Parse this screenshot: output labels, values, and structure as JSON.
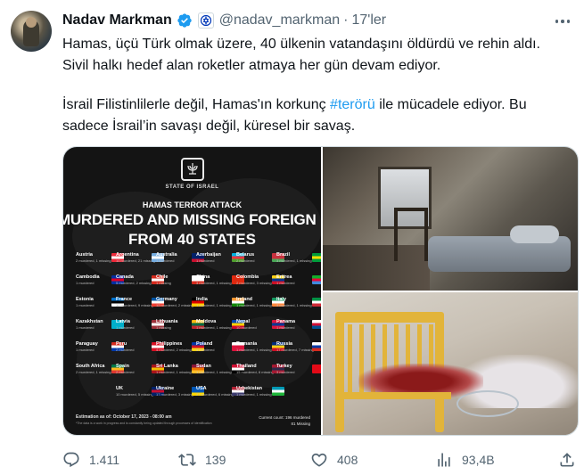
{
  "tweet": {
    "display_name": "Nadav Markman",
    "handle": "@nadav_markman",
    "separator": "·",
    "time": "17'ler",
    "paragraph1_line1": "Hamas, üçü Türk olmak üzere, 40 ülkenin vatandaşını öldürdü ve rehin aldı.",
    "paragraph1_line2": "Sivil halkı hedef alan roketler atmaya her gün devam ediyor.",
    "paragraph2_before": "İsrail Filistinlilerle değil, Hamas'ın korkunç ",
    "paragraph2_hashtag": "#terörü",
    "paragraph2_after": " ile mücadele ediyor. Bu",
    "paragraph2_line2": "sadece İsrail’in savaşı değil, küresel bir savaş."
  },
  "poster": {
    "state_label": "STATE OF ISRAEL",
    "subtitle": "HAMAS TERROR ATTACK",
    "title_line1": "MURDERED AND MISSING FOREIGN NATIONALS",
    "title_line2": "FROM 40 STATES",
    "countries": [
      {
        "name": "Austria",
        "note": "2 murdered, 1 missing",
        "flag": [
          "#ed2939",
          "#ffffff",
          "#ed2939"
        ]
      },
      {
        "name": "Argentina",
        "note": "10 murdered, 21 missing",
        "flag": [
          "#74acdf",
          "#ffffff",
          "#74acdf"
        ]
      },
      {
        "name": "Australia",
        "note": "1 murdered",
        "flag": [
          "#012169",
          "#012169",
          "#c8102e"
        ]
      },
      {
        "name": "Azerbaijan",
        "note": "1 murdered",
        "flag": [
          "#00b5e2",
          "#ef3340",
          "#509e2f"
        ]
      },
      {
        "name": "Belarus",
        "note": "2 murdered",
        "flag": [
          "#c8313e",
          "#c8313e",
          "#4aa657"
        ]
      },
      {
        "name": "Brazil",
        "note": "3 murdered, 1 missing",
        "flag": [
          "#009c3b",
          "#ffdf00",
          "#009c3b"
        ]
      },
      {
        "name": "Cambodia",
        "note": "1 murdered",
        "flag": [
          "#032ea1",
          "#e00025",
          "#032ea1"
        ]
      },
      {
        "name": "Canada",
        "note": "5 murdered, 2 missing",
        "flag": [
          "#d52b1e",
          "#ffffff",
          "#d52b1e"
        ]
      },
      {
        "name": "Chile",
        "note": "1 missing",
        "flag": [
          "#ffffff",
          "#ffffff",
          "#d52b1e"
        ]
      },
      {
        "name": "China",
        "note": "3 murdered, 1 missing",
        "flag": [
          "#de2910",
          "#de2910",
          "#de2910"
        ]
      },
      {
        "name": "Colombia",
        "note": "2 murdered, 3 missing",
        "flag": [
          "#fcd116",
          "#003893",
          "#ce1126"
        ]
      },
      {
        "name": "Eritrea",
        "note": "1 murdered",
        "flag": [
          "#12ad2b",
          "#ea0437",
          "#4189dd"
        ]
      },
      {
        "name": "Estonia",
        "note": "1 murdered",
        "flag": [
          "#0072ce",
          "#000000",
          "#ffffff"
        ]
      },
      {
        "name": "France",
        "note": "30 murdered, 9 missing",
        "flag": [
          "#0055a4",
          "#ffffff",
          "#ef4135"
        ]
      },
      {
        "name": "Germany",
        "note": "12 murdered, 2 missing",
        "flag": [
          "#000000",
          "#dd0000",
          "#ffce00"
        ]
      },
      {
        "name": "India",
        "note": "1 murdered, 1 missing",
        "flag": [
          "#ff9933",
          "#ffffff",
          "#138808"
        ]
      },
      {
        "name": "Ireland",
        "note": "1 murdered, 1 missing",
        "flag": [
          "#169b62",
          "#ffffff",
          "#ff883e"
        ]
      },
      {
        "name": "Italy",
        "note": "3 murdered, 1 missing",
        "flag": [
          "#009246",
          "#ffffff",
          "#ce2b37"
        ]
      },
      {
        "name": "Kazakhstan",
        "note": "1 murdered",
        "flag": [
          "#00afca",
          "#00afca",
          "#00afca"
        ]
      },
      {
        "name": "Latvia",
        "note": "1 murdered",
        "flag": [
          "#9e3039",
          "#ffffff",
          "#9e3039"
        ]
      },
      {
        "name": "Lithuania",
        "note": "1 missing",
        "flag": [
          "#fdb913",
          "#006a44",
          "#c1272d"
        ]
      },
      {
        "name": "Moldova",
        "note": "1 murdered, 1 missing",
        "flag": [
          "#0046ae",
          "#ffd200",
          "#cc092f"
        ]
      },
      {
        "name": "Nepal",
        "note": "10 murdered",
        "flag": [
          "#dc143c",
          "#003893",
          "#dc143c"
        ]
      },
      {
        "name": "Panama",
        "note": "1 murdered",
        "flag": [
          "#ffffff",
          "#d21034",
          "#005293"
        ]
      },
      {
        "name": "Paraguay",
        "note": "1 murdered",
        "flag": [
          "#d52b1e",
          "#ffffff",
          "#0038a8"
        ]
      },
      {
        "name": "Peru",
        "note": "2 murdered",
        "flag": [
          "#d91023",
          "#ffffff",
          "#d91023"
        ]
      },
      {
        "name": "Philippines",
        "note": "4 murdered, 2 missing",
        "flag": [
          "#0038a8",
          "#ce1126",
          "#fcd116"
        ]
      },
      {
        "name": "Poland",
        "note": "4 murdered",
        "flag": [
          "#ffffff",
          "#dc143c",
          "#dc143c"
        ]
      },
      {
        "name": "Romania",
        "note": "1 murdered, 1 missing",
        "flag": [
          "#002b7f",
          "#fcd116",
          "#ce1126"
        ]
      },
      {
        "name": "Russia",
        "note": "17 murdered, 7 missing",
        "flag": [
          "#ffffff",
          "#0039a6",
          "#d52b1e"
        ]
      },
      {
        "name": "South Africa",
        "note": "2 murdered, 1 missing",
        "flag": [
          "#007749",
          "#ffb81c",
          "#de3831"
        ]
      },
      {
        "name": "Spain",
        "note": "2 murdered",
        "flag": [
          "#aa151b",
          "#f1bf00",
          "#aa151b"
        ]
      },
      {
        "name": "Sri Lanka",
        "note": "1 murdered, 1 missing",
        "flag": [
          "#8d153a",
          "#eb7400",
          "#ffbe29"
        ]
      },
      {
        "name": "Sudan",
        "note": "1 murdered, 1 missing",
        "flag": [
          "#d21034",
          "#ffffff",
          "#000000"
        ]
      },
      {
        "name": "Thailand",
        "note": "15 murdered, 8 missing",
        "flag": [
          "#a51931",
          "#2d2a4a",
          "#a51931"
        ]
      },
      {
        "name": "Turkey",
        "note": "3 murdered",
        "flag": [
          "#e30a17",
          "#e30a17",
          "#e30a17"
        ]
      },
      {
        "name": "UK",
        "note": "10 murdered, 5 missing",
        "flag": [
          "#012169",
          "#c8102e",
          "#012169"
        ]
      },
      {
        "name": "Ukraine",
        "note": "17 murdered, 3 missing",
        "flag": [
          "#0057b7",
          "#0057b7",
          "#ffd700"
        ]
      },
      {
        "name": "USA",
        "note": "27 murdered, 6 missing",
        "flag": [
          "#b22234",
          "#ffffff",
          "#3c3b6e"
        ]
      },
      {
        "name": "Uzbekistan",
        "note": "1 murdered, 1 missing",
        "flag": [
          "#0099b5",
          "#ffffff",
          "#1eb53a"
        ]
      }
    ],
    "footer_left": "Estimation as of: October 17, 2023 - 08:00 am",
    "footer_left_small": "*The data is a work in progress and is constantly being updated through processes of identification",
    "footer_right_1": "Current count: 196 murdered",
    "footer_right_2": "81 Missing"
  },
  "actions": {
    "reply_count": "1.411",
    "retweet_count": "139",
    "like_count": "408",
    "views_count": "93,4B"
  },
  "icons": {
    "verified": "verified-badge-icon",
    "affiliation": "israel-emblem-icon",
    "more": "more-options-icon",
    "reply": "reply-icon",
    "retweet": "retweet-icon",
    "like": "heart-icon",
    "views": "views-chart-icon",
    "share": "share-icon"
  },
  "colors": {
    "accent": "#1d9bf0",
    "text": "#0f1419",
    "secondary": "#536471"
  }
}
